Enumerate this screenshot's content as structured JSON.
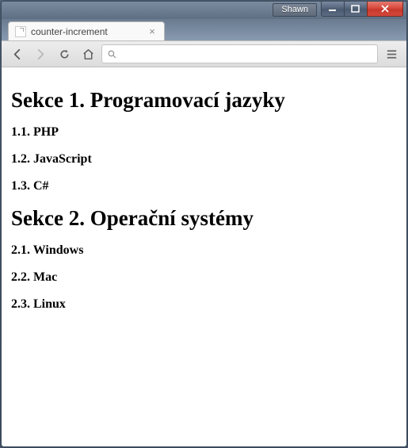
{
  "window": {
    "user_label": "Shawn"
  },
  "browser": {
    "tab_title": "counter-increment",
    "address_value": ""
  },
  "document": {
    "section_prefix": "Sekce",
    "sections": [
      {
        "number": "1",
        "title": "Programovací jazyky",
        "items": [
          {
            "number": "1.1",
            "label": "PHP"
          },
          {
            "number": "1.2",
            "label": "JavaScript"
          },
          {
            "number": "1.3",
            "label": "C#"
          }
        ]
      },
      {
        "number": "2",
        "title": "Operační systémy",
        "items": [
          {
            "number": "2.1",
            "label": "Windows"
          },
          {
            "number": "2.2",
            "label": "Mac"
          },
          {
            "number": "2.3",
            "label": "Linux"
          }
        ]
      }
    ]
  }
}
